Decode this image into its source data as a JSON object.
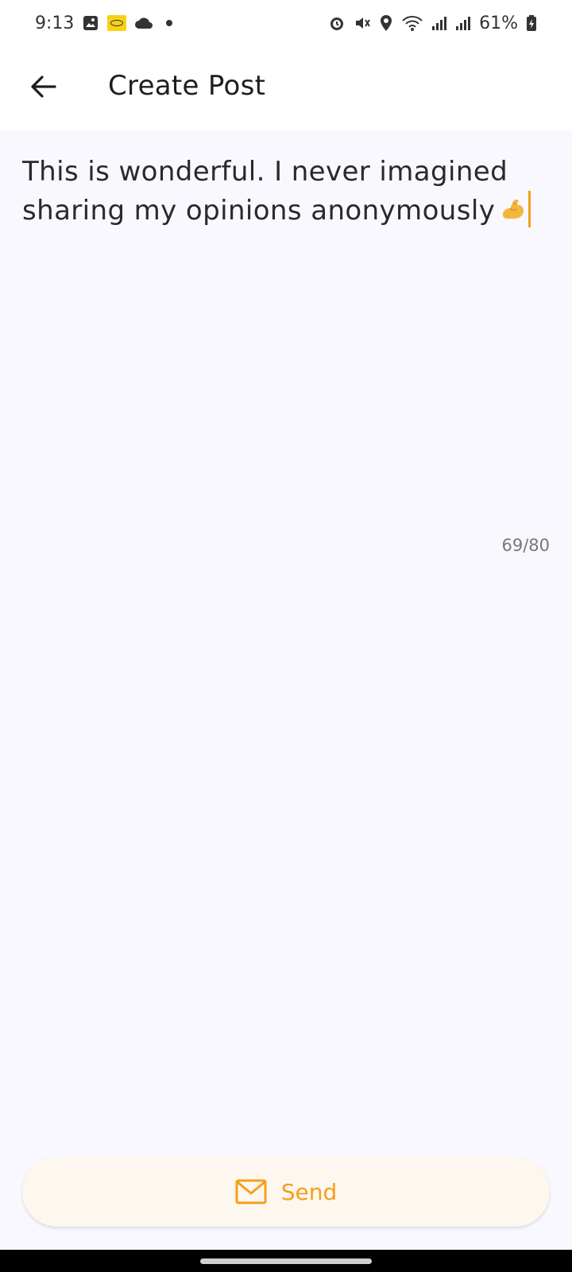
{
  "status_bar": {
    "time": "9:13",
    "battery": "61%",
    "left_icons": [
      "image-icon",
      "mtn-icon",
      "cloud-icon",
      "dot-icon"
    ],
    "right_icons": [
      "alarm-icon",
      "mute-icon",
      "location-icon",
      "wifi-icon",
      "signal-icon",
      "signal-icon",
      "battery-icon"
    ]
  },
  "header": {
    "title": "Create Post",
    "back_icon": "arrow-left-icon"
  },
  "post": {
    "text_line1": "This is wonderful. I never imagined",
    "text_line2": "sharing my opinions anonymously",
    "emoji": "flexed-biceps-icon",
    "char_count": "69/80"
  },
  "actions": {
    "send_label": "Send",
    "send_icon": "envelope-icon"
  },
  "colors": {
    "accent": "#f5a01a",
    "background": "#f9f8fe",
    "send_bg": "#fdf7ef"
  }
}
